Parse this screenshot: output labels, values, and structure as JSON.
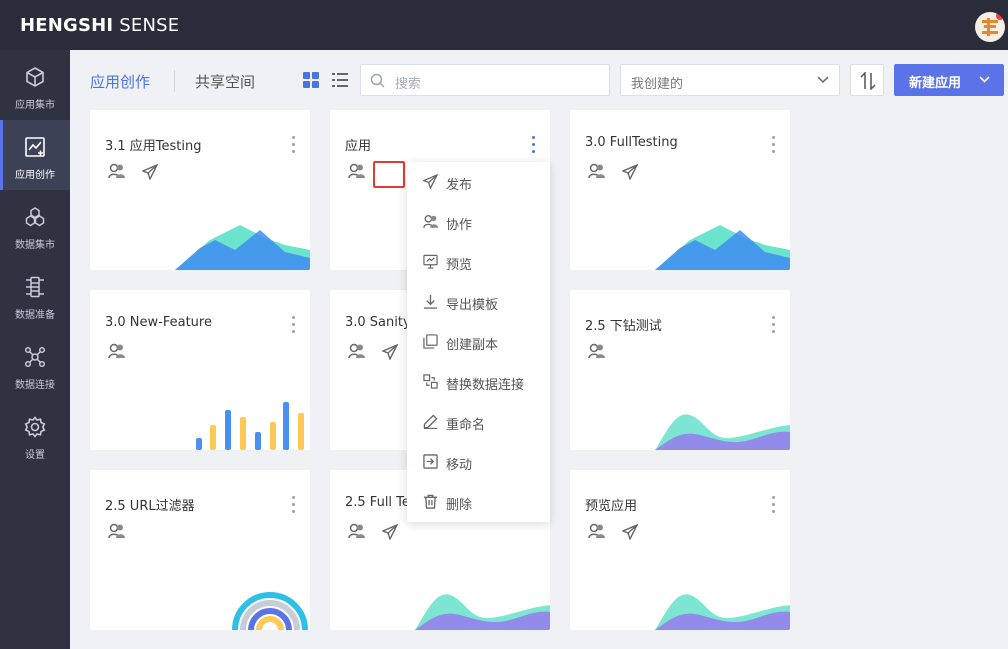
{
  "header": {
    "brand_bold": "HENGSHI",
    "brand_light": "SENSE"
  },
  "sidebar": {
    "items": [
      {
        "label": "应用集市",
        "icon": "cube-icon"
      },
      {
        "label": "应用创作",
        "icon": "chart-edit-icon",
        "active": true
      },
      {
        "label": "数据集市",
        "icon": "hexagon-cluster-icon"
      },
      {
        "label": "数据准备",
        "icon": "data-prep-icon"
      },
      {
        "label": "数据连接",
        "icon": "network-icon"
      },
      {
        "label": "设置",
        "icon": "gear-icon"
      }
    ]
  },
  "toolbar": {
    "tab_create": "应用创作",
    "tab_share": "共享空间",
    "search_placeholder": "搜索",
    "filter_value": "我创建的",
    "new_button": "新建应用"
  },
  "cards": [
    {
      "title": "3.1 应用Testing"
    },
    {
      "title": "应用"
    },
    {
      "title": "3.0 FullTesting"
    },
    {
      "title": "3.0 New-Feature"
    },
    {
      "title": "3.0 Sanity"
    },
    {
      "title": "2.5 下钻测试"
    },
    {
      "title": "2.5 URL过滤器"
    },
    {
      "title": "2.5 Full Te"
    },
    {
      "title": "预览应用"
    }
  ],
  "context_menu": {
    "items": [
      {
        "label": "发布",
        "icon": "send-icon"
      },
      {
        "label": "协作",
        "icon": "user-icon"
      },
      {
        "label": "预览",
        "icon": "preview-icon"
      },
      {
        "label": "导出模板",
        "icon": "download-icon"
      },
      {
        "label": "创建副本",
        "icon": "copy-icon"
      },
      {
        "label": "替换数据连接",
        "icon": "replace-connection-icon"
      },
      {
        "label": "重命名",
        "icon": "pen-icon"
      },
      {
        "label": "移动",
        "icon": "move-icon"
      },
      {
        "label": "删除",
        "icon": "trash-icon"
      }
    ]
  },
  "colors": {
    "accent": "#5b73e8",
    "topbar": "#2a2c3a",
    "sidebar": "#2f3241",
    "highlight": "#e53935"
  }
}
